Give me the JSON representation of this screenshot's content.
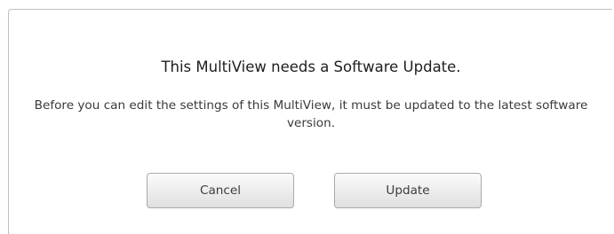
{
  "dialog": {
    "title": "This MultiView needs a Software Update.",
    "message": "Before you can edit the settings of this MultiView, it must be updated to the latest software version.",
    "buttons": {
      "cancel_label": "Cancel",
      "update_label": "Update"
    }
  }
}
